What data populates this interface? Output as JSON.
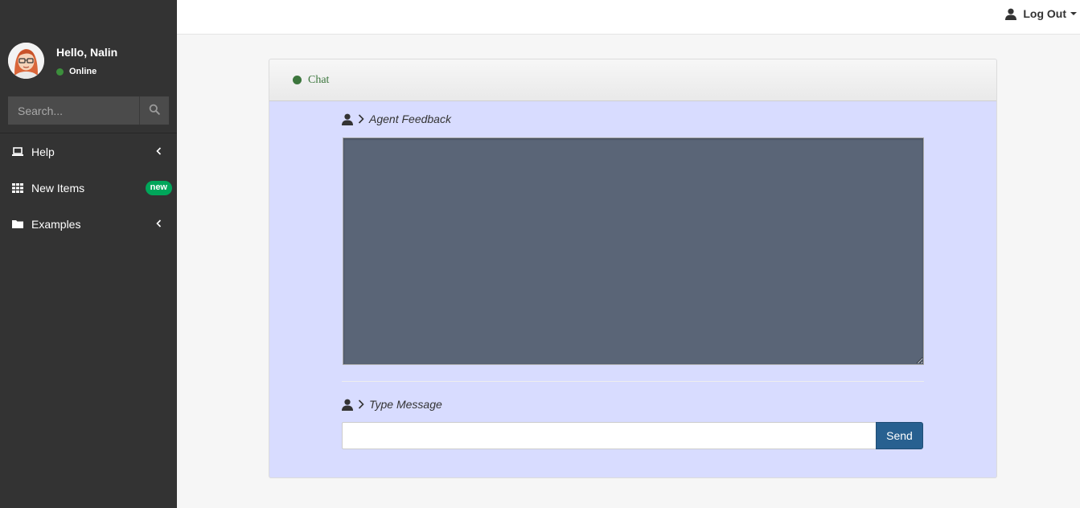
{
  "user": {
    "greeting": "Hello, Nalin",
    "status": "Online"
  },
  "search": {
    "placeholder": "Search..."
  },
  "sidebar": {
    "items": [
      {
        "label": "Help",
        "icon": "laptop-icon",
        "has_chevron": true
      },
      {
        "label": "New Items",
        "icon": "grid-icon",
        "badge": "new"
      },
      {
        "label": "Examples",
        "icon": "folder-icon",
        "has_chevron": true
      }
    ]
  },
  "topbar": {
    "logout_label": "Log Out"
  },
  "chat": {
    "title": "Chat",
    "feedback_label": "Agent Feedback",
    "message_label": "Type Message",
    "message_value": "",
    "send_label": "Send"
  },
  "colors": {
    "sidebar_bg": "#333333",
    "panel_body": "#d8dcff",
    "feedback_bg": "#5a6577",
    "online": "#3c8f3c",
    "badge": "#00a65a",
    "send_button": "#286090",
    "chat_title": "#3c763d"
  }
}
